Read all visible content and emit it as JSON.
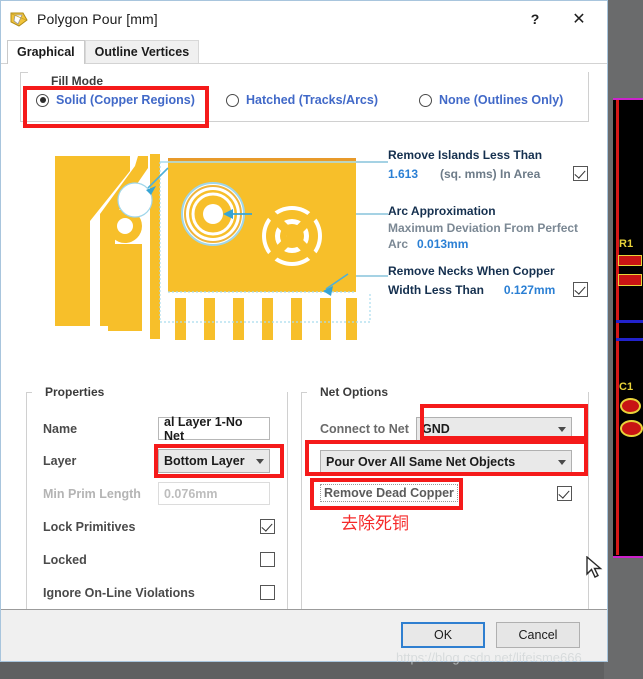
{
  "window": {
    "title": "Polygon Pour [mm]",
    "icon": "polygon-pour-icon",
    "help_label": "?",
    "close_label": "✕"
  },
  "tabs": [
    {
      "label": "Graphical",
      "active": true
    },
    {
      "label": "Outline Vertices",
      "active": false
    }
  ],
  "fill_mode": {
    "legend": "Fill Mode",
    "options": [
      {
        "label": "Solid (Copper Regions)",
        "selected": true
      },
      {
        "label": "Hatched (Tracks/Arcs)",
        "selected": false
      },
      {
        "label": "None (Outlines Only)",
        "selected": false
      }
    ]
  },
  "preview": {
    "remove_islands": {
      "title": "Remove Islands Less Than",
      "value": "1.613",
      "units": "(sq. mms) In Area",
      "checked": true
    },
    "arc_approximation": {
      "title": "Arc Approximation",
      "desc_line1": "Maximum Deviation From Perfect",
      "desc_line2": "Arc",
      "value": "0.013mm"
    },
    "remove_necks": {
      "title": "Remove Necks When Copper",
      "subtitle": "Width Less Than",
      "value": "0.127mm",
      "checked": true
    }
  },
  "properties": {
    "legend": "Properties",
    "name_label": "Name",
    "name_value": "al Layer 1-No Net",
    "layer_label": "Layer",
    "layer_value": "Bottom Layer",
    "min_prim_label": "Min Prim Length",
    "min_prim_value": "0.076mm",
    "lock_primitives_label": "Lock Primitives",
    "lock_primitives_checked": true,
    "locked_label": "Locked",
    "locked_checked": false,
    "ignore_online_label": "Ignore On-Line Violations",
    "ignore_online_checked": false
  },
  "net_options": {
    "legend": "Net Options",
    "connect_label": "Connect to Net",
    "connect_value": "GND",
    "pour_value": "Pour Over All Same Net Objects",
    "remove_dead_copper_label": "Remove Dead Copper",
    "remove_dead_copper_checked": true
  },
  "footer": {
    "ok_label": "OK",
    "cancel_label": "Cancel"
  },
  "annotation": {
    "chinese_note": "去除死铜",
    "color": "#f52a2a"
  },
  "watermark": {
    "text": "https://blog.csdn.net/lifeisme666"
  },
  "background_editor": {
    "labels": [
      "R1",
      "C1"
    ]
  }
}
